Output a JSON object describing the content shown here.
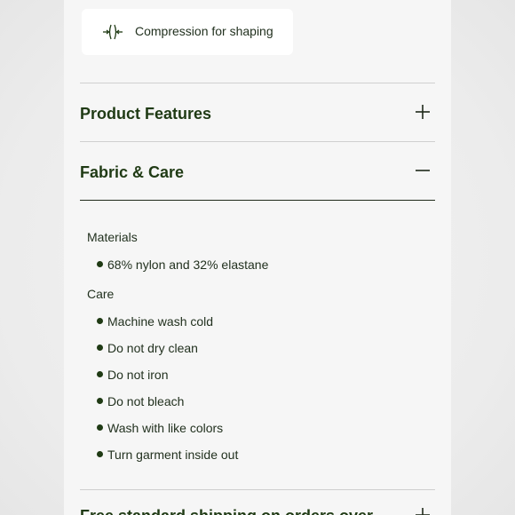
{
  "feature_chip": {
    "icon": "compression-icon",
    "label": "Compression for shaping"
  },
  "accordion": {
    "product_features": {
      "title": "Product Features",
      "toggle": "+",
      "expanded": false
    },
    "fabric_care": {
      "title": "Fabric & Care",
      "toggle": "−",
      "expanded": true,
      "materials": {
        "label": "Materials",
        "items": [
          "68% nylon and 32% elastane"
        ]
      },
      "care": {
        "label": "Care",
        "items": [
          "Machine wash cold",
          "Do not dry clean",
          "Do not iron",
          "Do not bleach",
          "Wash with like colors",
          "Turn garment inside out"
        ]
      }
    },
    "shipping": {
      "title": "Free standard shipping on orders over",
      "toggle": "+",
      "expanded": false
    }
  },
  "colors": {
    "heading": "#1f3a14",
    "text": "#22311f",
    "divider": "#cfcfcf",
    "divider_active": "#1f2a1a",
    "chip_bg": "#ffffff"
  }
}
